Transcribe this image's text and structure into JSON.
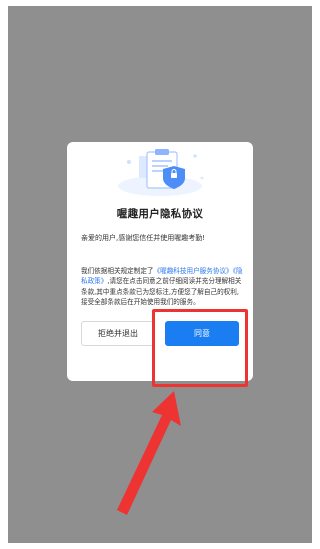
{
  "dialog": {
    "title": "喔趣用户隐私协议",
    "greeting": "亲爱的用户,感谢您信任并使用喔趣考勤!",
    "body_prefix": "我们依据相关规定制定了",
    "link_terms": "《喔趣科技用户服务协议》",
    "link_privacy": "《隐私政策》",
    "body_suffix": ",请您在点击同意之前仔细阅读并充分理解相关条款,其中重点条款已为您标注,方便您了解自己的权利,接受全部条款后在开始使用我们的服务。",
    "reject_label": "拒绝并退出",
    "agree_label": "同意"
  },
  "colors": {
    "overlay": "#8f8f8f",
    "primary": "#1a7df2",
    "link": "#2a78f0",
    "annotation": "#ee3333"
  },
  "icons": [
    "document-shield-illustration"
  ]
}
